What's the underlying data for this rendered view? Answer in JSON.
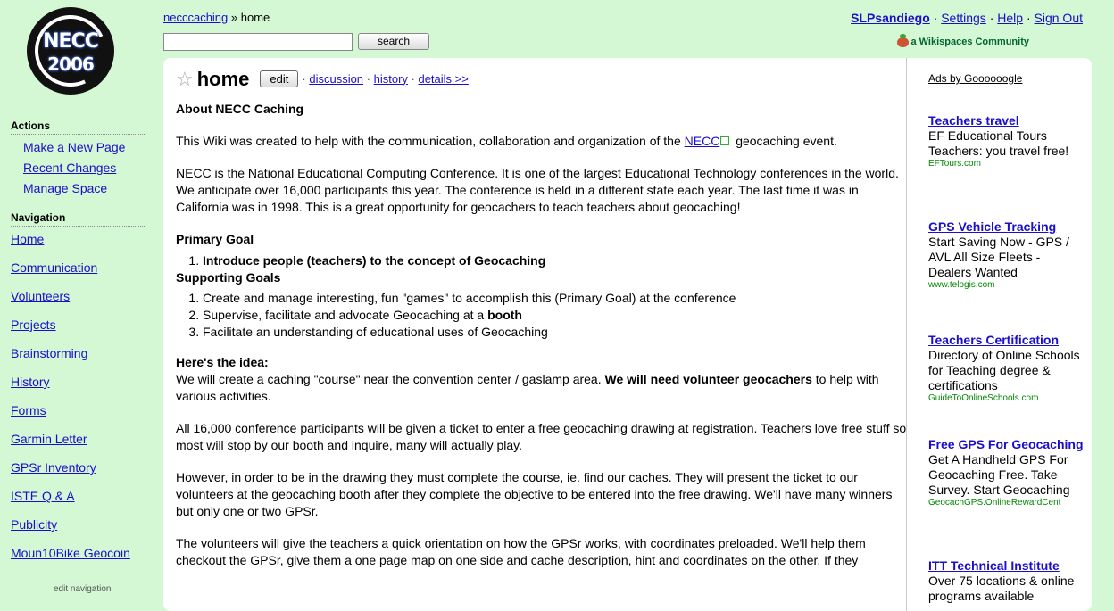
{
  "logo": {
    "line1": "NECC",
    "line2": "2006"
  },
  "breadcrumb": {
    "space": "necccaching",
    "sep": " » ",
    "page": "home"
  },
  "search": {
    "placeholder": "",
    "button": "search"
  },
  "userlinks": {
    "user": "SLPsandiego",
    "settings": "Settings",
    "help": "Help",
    "signout": "Sign Out",
    "sep": " · "
  },
  "community": "a Wikispaces Community",
  "sidebar": {
    "actions_title": "Actions",
    "actions": [
      "Make a New Page",
      "Recent Changes",
      "Manage Space"
    ],
    "nav_title": "Navigation",
    "nav": [
      "Home",
      "Communication",
      "Volunteers",
      "Projects",
      "Brainstorming",
      "History",
      "Forms",
      "Garmin Letter",
      "GPSr Inventory",
      "ISTE Q & A",
      "Publicity",
      "Moun10Bike Geocoin"
    ],
    "edit_nav": "edit navigation"
  },
  "page": {
    "title": "home",
    "edit": "edit",
    "tabs": [
      "discussion",
      "history",
      "details >>"
    ],
    "tab_sep": " · ",
    "about": "About NECC Caching",
    "p1_before": "This Wiki was created to help with the communication, collaboration and organization of the ",
    "p1_link": "NECC",
    "p1_after": " geocaching event.",
    "p2": "NECC is the National Educational Computing Conference. It is one of the largest Educational Technology conferences in the world. We anticipate over 16,000 participants this year. The conference is held in a different state each year. The last time it was in California was in 1998. This is a great opportunity for geocachers to teach teachers about geocaching!",
    "primary_goal": "Primary Goal",
    "goal1": "Introduce people (teachers) to the concept of Geocaching",
    "supporting": "Supporting Goals",
    "s1": "Create and manage interesting, fun \"games\" to accomplish this (Primary Goal) at the conference",
    "s2_before": "Supervise, facilitate and advocate Geocaching at a ",
    "s2_bold": "booth",
    "s3": "Facilitate an understanding of educational uses of Geocaching",
    "idea": "Here's the idea:",
    "p3_before": "We will create a caching \"course\" near the convention center / gaslamp area. ",
    "p3_bold": "We will need volunteer geocachers",
    "p3_after": " to help with various activities.",
    "p4": "All 16,000 conference participants will be given a ticket to enter a free geocaching drawing at registration. Teachers love free stuff so most will stop by our booth and inquire, many will actually play.",
    "p5": "However, in order to be in the drawing they must complete the course, ie. find our caches. They will present the ticket to our volunteers at the geocaching booth after they complete the objective to be entered into the free drawing. We'll have many winners but only one or two GPSr.",
    "p6": "The volunteers will give the teachers a quick orientation on how the GPSr works, with coordinates preloaded. We'll help them checkout the GPSr, give them a one page map on one side and cache description, hint and coordinates on the other. If they"
  },
  "ads": {
    "header": "Ads by Goooooogle",
    "items": [
      {
        "title": "Teachers travel",
        "desc": "EF Educational Tours Teachers: you travel free!",
        "url": "EFTours.com"
      },
      {
        "title": "GPS Vehicle Tracking",
        "desc": "Start Saving Now - GPS / AVL All Size Fleets - Dealers Wanted",
        "url": "www.telogis.com"
      },
      {
        "title": "Teachers Certification",
        "desc": "Directory of Online Schools for Teaching degree & certifications",
        "url": "GuideToOnlineSchools.com"
      },
      {
        "title": "Free GPS For Geocaching",
        "desc": "Get A Handheld GPS For Geocaching Free. Take Survey. Start Geocaching",
        "url": "GeocachGPS.OnlineRewardCent"
      },
      {
        "title": "ITT Technical Institute",
        "desc": "Over 75 locations & online programs available",
        "url": ""
      }
    ]
  }
}
